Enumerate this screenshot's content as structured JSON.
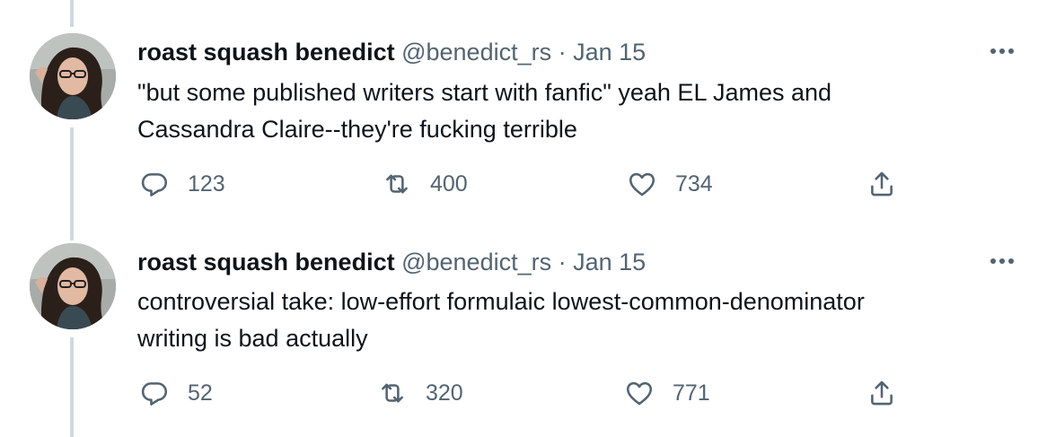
{
  "tweets": [
    {
      "display_name": "roast squash benedict",
      "handle": "@benedict_rs",
      "separator": "·",
      "date": "Jan 15",
      "text_line1": "\"but some published writers start with fanfic\" yeah EL James and",
      "text_line2": "Cassandra Claire--they're fucking terrible",
      "replies": "123",
      "retweets": "400",
      "likes": "734"
    },
    {
      "display_name": "roast squash benedict",
      "handle": "@benedict_rs",
      "separator": "·",
      "date": "Jan 15",
      "text_line1": "controversial take: low-effort formulaic lowest-common-denominator",
      "text_line2": "writing is bad actually",
      "replies": "52",
      "retweets": "320",
      "likes": "771"
    }
  ],
  "icons": {
    "reply": "reply-icon",
    "retweet": "retweet-icon",
    "like": "heart-icon",
    "share": "share-icon",
    "more": "more-icon"
  },
  "colors": {
    "text": "#0f1419",
    "secondary": "#536471",
    "thread_line": "#cfd9de"
  }
}
